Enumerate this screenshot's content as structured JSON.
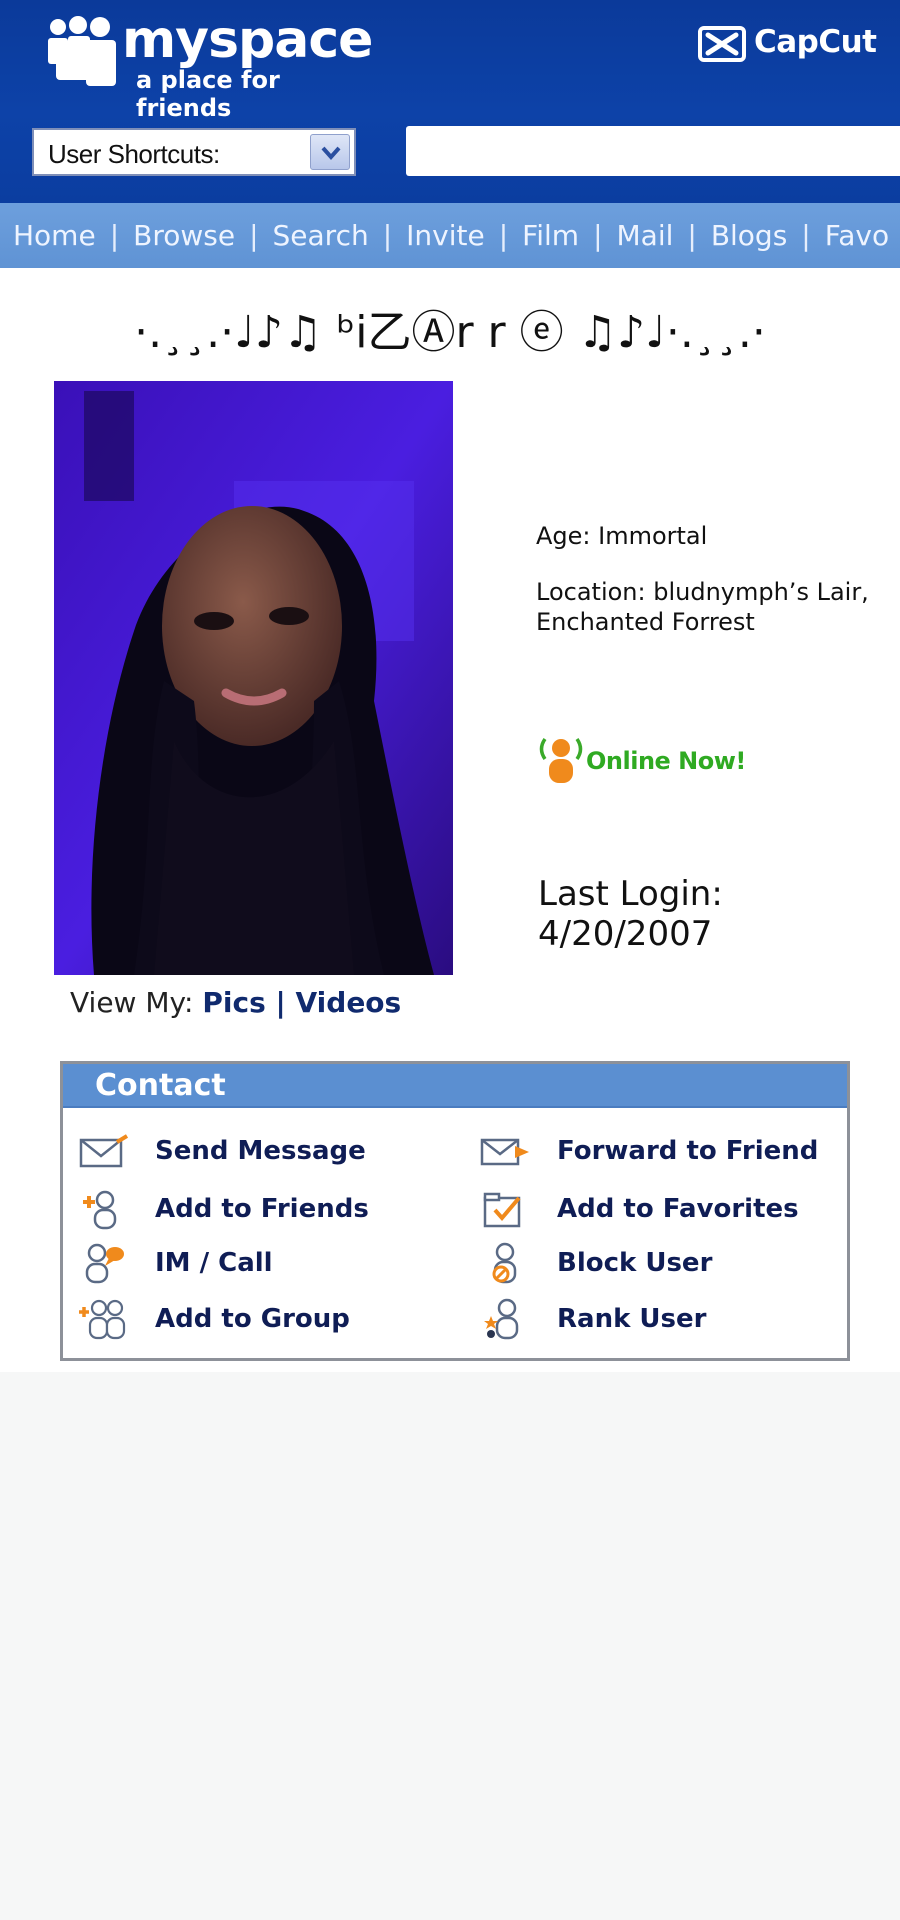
{
  "header": {
    "logo_word": "myspace",
    "logo_tagline": "a place for friends",
    "capcut_label": "CapCut",
    "shortcuts_label": "User Shortcuts:",
    "nav": [
      "Home",
      "Browse",
      "Search",
      "Invite",
      "Film",
      "Mail",
      "Blogs",
      "Favo"
    ]
  },
  "profile": {
    "display_name": "·.¸¸.·♩♪♫ ᵇi乙Ⓐr r ⓔ ♫♪♩·.¸¸.·",
    "age": "Age: Immortal",
    "location": "Location: bludnymph’s Lair, Enchanted Forrest",
    "online_status": "Online Now!",
    "last_login_label": "Last Login:",
    "last_login_date": "4/20/2007",
    "view_my_label": "View My: ",
    "pics_link": "Pics",
    "view_sep": " | ",
    "videos_link": "Videos"
  },
  "contact": {
    "title": "Contact",
    "items": [
      {
        "label": "Send Message",
        "icon": "envelope-icon"
      },
      {
        "label": "Forward to Friend",
        "icon": "forward-envelope-icon"
      },
      {
        "label": "Add to Friends",
        "icon": "add-friend-icon"
      },
      {
        "label": "Add to Favorites",
        "icon": "favorite-check-icon"
      },
      {
        "label": "IM / Call",
        "icon": "im-call-icon"
      },
      {
        "label": "Block User",
        "icon": "block-user-icon"
      },
      {
        "label": "Add to Group",
        "icon": "add-group-icon"
      },
      {
        "label": "Rank User",
        "icon": "rank-user-icon"
      }
    ]
  },
  "colors": {
    "header_blue": "#0d42a8",
    "nav_blue": "#6d9fdd",
    "contact_head": "#5b8fd1",
    "online_green": "#2faa22",
    "accent_orange": "#f08a1c"
  }
}
